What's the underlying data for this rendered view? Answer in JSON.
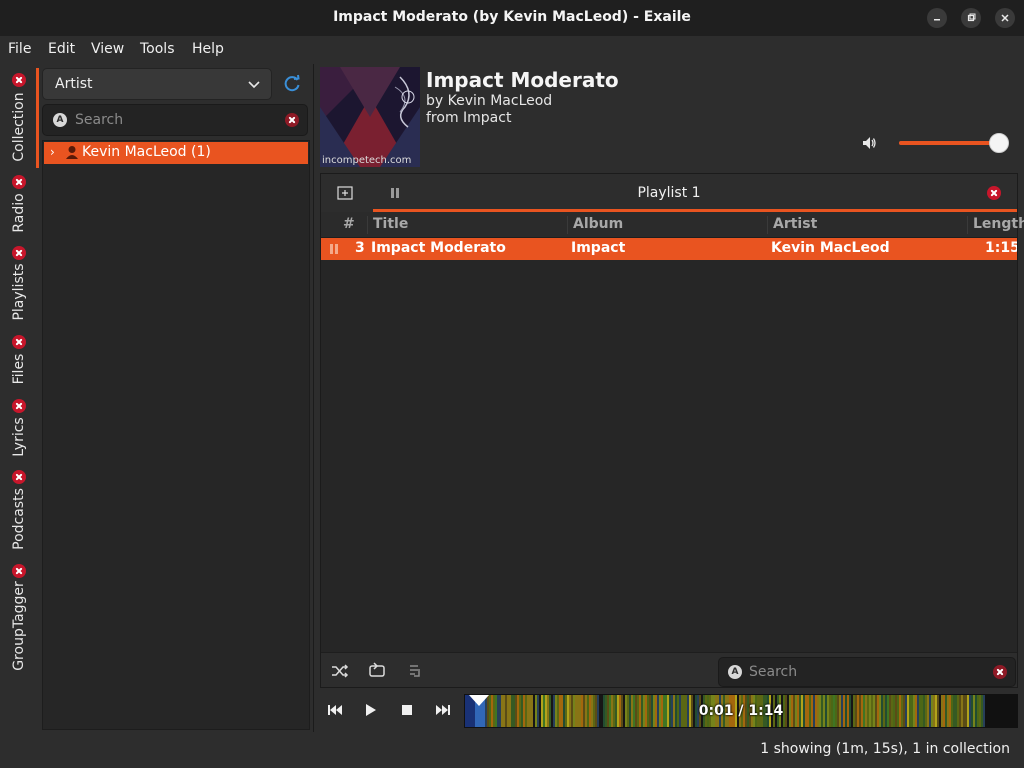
{
  "window": {
    "title": "Impact Moderato (by Kevin MacLeod) - Exaile"
  },
  "menu": {
    "file": "File",
    "edit": "Edit",
    "view": "View",
    "tools": "Tools",
    "help": "Help"
  },
  "side_tabs": [
    "Collection",
    "Radio",
    "Playlists",
    "Files",
    "Lyrics",
    "Podcasts",
    "GroupTagger"
  ],
  "collection": {
    "view_mode": "Artist",
    "search_placeholder": "Search",
    "tree_item": "Kevin MacLeod (1)"
  },
  "now_playing": {
    "title": "Impact Moderato",
    "artist_line": "by Kevin MacLeod",
    "album_line": "from Impact",
    "cover_text": "incompetech.com",
    "volume": 1.0
  },
  "playlist": {
    "name": "Playlist 1",
    "columns": {
      "num": "#",
      "title": "Title",
      "album": "Album",
      "artist": "Artist",
      "length": "Length"
    },
    "rows": [
      {
        "num": "3",
        "title": "Impact Moderato",
        "album": "Impact",
        "artist": "Kevin MacLeod",
        "length": "1:15"
      }
    ],
    "search_placeholder": "Search"
  },
  "seek": {
    "time": "0:01 / 1:14"
  },
  "status": {
    "text": "1 showing (1m, 15s), 1 in collection"
  },
  "colors": {
    "accent": "#e95420",
    "close": "#c7162b",
    "background": "#2d2d2d"
  }
}
